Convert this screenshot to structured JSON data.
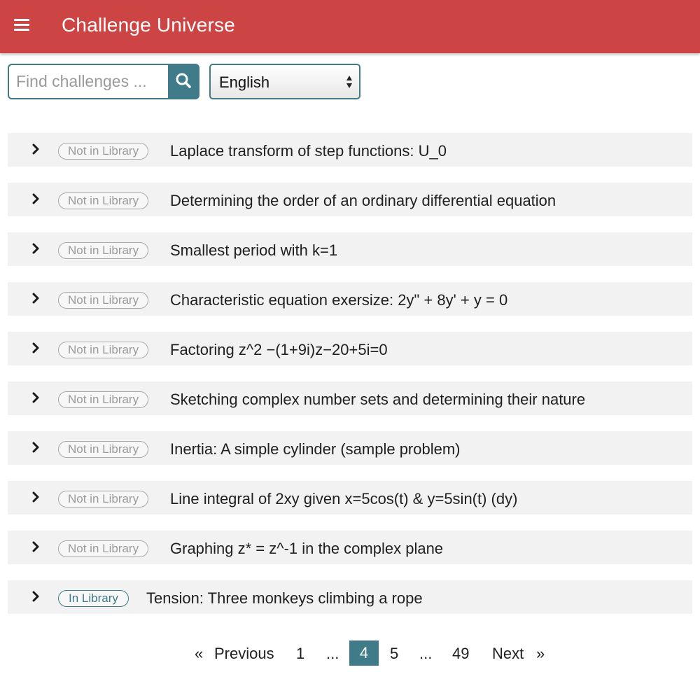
{
  "header": {
    "title": "Challenge Universe",
    "menu_icon": "hamburger-menu-icon",
    "background": "#cd4444"
  },
  "search": {
    "placeholder": "Find challenges ...",
    "value": "",
    "button_icon": "search-icon"
  },
  "language": {
    "selected": "English"
  },
  "accent_color": "#3f7b89",
  "challenges": [
    {
      "status": "Not in Library",
      "title": "Laplace transform of step functions: U_0"
    },
    {
      "status": "Not in Library",
      "title": "Determining the order of an ordinary differential equation"
    },
    {
      "status": "Not in Library",
      "title": "Smallest period with k=1"
    },
    {
      "status": "Not in Library",
      "title": "Characteristic equation exersize: 2y\" + 8y' + y = 0"
    },
    {
      "status": "Not in Library",
      "title": "Factoring z^2 −(1+9i)z−20+5i=0"
    },
    {
      "status": "Not in Library",
      "title": "Sketching complex number sets and determining their nature"
    },
    {
      "status": "Not in Library",
      "title": "Inertia: A simple cylinder (sample problem)"
    },
    {
      "status": "Not in Library",
      "title": "Line integral of 2xy given x=5cos(t) & y=5sin(t) (dy)"
    },
    {
      "status": "Not in Library",
      "title": "Graphing z* = z^-1 in the complex plane"
    },
    {
      "status": "In Library",
      "title": "Tension: Three monkeys climbing a rope"
    }
  ],
  "pagination": {
    "prev_symbol": "«",
    "prev_label": "Previous",
    "first": "1",
    "ellipsis": "...",
    "current": "4",
    "next_page": "5",
    "last": "49",
    "next_label": "Next",
    "next_symbol": "»"
  }
}
